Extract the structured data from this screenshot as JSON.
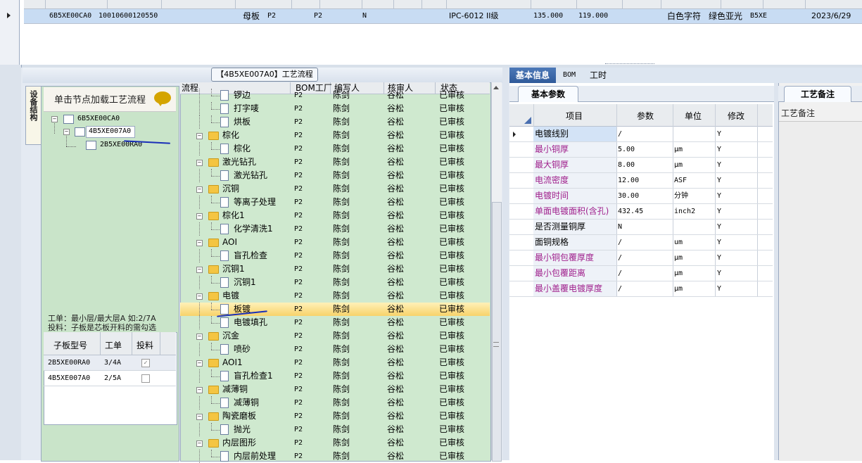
{
  "top_grid": {
    "row": {
      "col1": "6B5XE00CA0",
      "col2": "10010600120550",
      "col3": "母板",
      "col4": "P2",
      "col5": "P2",
      "col6": "N",
      "col7": "IPC-6012 II级",
      "col8": "135.000",
      "col9": "119.000",
      "col10": "白色字符",
      "col11": "绿色亚光",
      "col12": "B5XE",
      "col13": "2023/6/29"
    }
  },
  "workflow": {
    "title": "【4B5XE007A0】工艺流程",
    "vertical_tab": "设备结构",
    "hint": "单击节点加载工艺流程",
    "tree": [
      "6B5XE00CA0",
      "4B5XE007A0",
      "2B5XE00RA0"
    ],
    "info_line1": "工单：最小层/最大层A 如:2/7A",
    "info_line2": "投料：子板是芯板开料的需勾选",
    "sub_table": {
      "headers": [
        "子板型号",
        "工单",
        "投料"
      ],
      "rows": [
        {
          "model": "2B5XE00RA0",
          "order": "3/4A",
          "feed": true
        },
        {
          "model": "4B5XE007A0",
          "order": "2/5A",
          "feed": false
        }
      ]
    }
  },
  "process_grid": {
    "headers": [
      "流程",
      "BOM工厂",
      "编写人",
      "核审人",
      "状态"
    ],
    "rows": [
      {
        "name": "锣边",
        "level": 1,
        "factory": "P2",
        "writer": "陈剑",
        "reviewer": "谷松",
        "status": "已审核"
      },
      {
        "name": "打字唛",
        "level": 1,
        "factory": "P2",
        "writer": "陈剑",
        "reviewer": "谷松",
        "status": "已审核"
      },
      {
        "name": "烘板",
        "level": 1,
        "factory": "P2",
        "writer": "陈剑",
        "reviewer": "谷松",
        "status": "已审核"
      },
      {
        "name": "棕化",
        "level": 0,
        "factory": "P2",
        "writer": "陈剑",
        "reviewer": "谷松",
        "status": "已审核"
      },
      {
        "name": "棕化",
        "level": 1,
        "factory": "P2",
        "writer": "陈剑",
        "reviewer": "谷松",
        "status": "已审核"
      },
      {
        "name": "激光钻孔",
        "level": 0,
        "factory": "P2",
        "writer": "陈剑",
        "reviewer": "谷松",
        "status": "已审核"
      },
      {
        "name": "激光钻孔",
        "level": 1,
        "factory": "P2",
        "writer": "陈剑",
        "reviewer": "谷松",
        "status": "已审核"
      },
      {
        "name": "沉铜",
        "level": 0,
        "factory": "P2",
        "writer": "陈剑",
        "reviewer": "谷松",
        "status": "已审核"
      },
      {
        "name": "等离子处理",
        "level": 1,
        "factory": "P2",
        "writer": "陈剑",
        "reviewer": "谷松",
        "status": "已审核"
      },
      {
        "name": "棕化1",
        "level": 0,
        "factory": "P2",
        "writer": "陈剑",
        "reviewer": "谷松",
        "status": "已审核"
      },
      {
        "name": "化学清洗1",
        "level": 1,
        "factory": "P2",
        "writer": "陈剑",
        "reviewer": "谷松",
        "status": "已审核"
      },
      {
        "name": "AOI",
        "level": 0,
        "factory": "P2",
        "writer": "陈剑",
        "reviewer": "谷松",
        "status": "已审核"
      },
      {
        "name": "盲孔检查",
        "level": 1,
        "factory": "P2",
        "writer": "陈剑",
        "reviewer": "谷松",
        "status": "已审核"
      },
      {
        "name": "沉铜1",
        "level": 0,
        "factory": "P2",
        "writer": "陈剑",
        "reviewer": "谷松",
        "status": "已审核"
      },
      {
        "name": "沉铜1",
        "level": 1,
        "factory": "P2",
        "writer": "陈剑",
        "reviewer": "谷松",
        "status": "已审核"
      },
      {
        "name": "电镀",
        "level": 0,
        "factory": "P2",
        "writer": "陈剑",
        "reviewer": "谷松",
        "status": "已审核"
      },
      {
        "name": "板镀",
        "level": 1,
        "factory": "P2",
        "writer": "陈剑",
        "reviewer": "谷松",
        "status": "已审核"
      },
      {
        "name": "电镀填孔",
        "level": 1,
        "factory": "P2",
        "writer": "陈剑",
        "reviewer": "谷松",
        "status": "已审核"
      },
      {
        "name": "沉金",
        "level": 0,
        "factory": "P2",
        "writer": "陈剑",
        "reviewer": "谷松",
        "status": "已审核"
      },
      {
        "name": "喷砂",
        "level": 1,
        "factory": "P2",
        "writer": "陈剑",
        "reviewer": "谷松",
        "status": "已审核"
      },
      {
        "name": "AOI1",
        "level": 0,
        "factory": "P2",
        "writer": "陈剑",
        "reviewer": "谷松",
        "status": "已审核"
      },
      {
        "name": "盲孔检查1",
        "level": 1,
        "factory": "P2",
        "writer": "陈剑",
        "reviewer": "谷松",
        "status": "已审核"
      },
      {
        "name": "减薄铜",
        "level": 0,
        "factory": "P2",
        "writer": "陈剑",
        "reviewer": "谷松",
        "status": "已审核"
      },
      {
        "name": "减薄铜",
        "level": 1,
        "factory": "P2",
        "writer": "陈剑",
        "reviewer": "谷松",
        "status": "已审核"
      },
      {
        "name": "陶瓷磨板",
        "level": 0,
        "factory": "P2",
        "writer": "陈剑",
        "reviewer": "谷松",
        "status": "已审核"
      },
      {
        "name": "抛光",
        "level": 1,
        "factory": "P2",
        "writer": "陈剑",
        "reviewer": "谷松",
        "status": "已审核"
      },
      {
        "name": "内层图形",
        "level": 0,
        "factory": "P2",
        "writer": "陈剑",
        "reviewer": "谷松",
        "status": "已审核"
      },
      {
        "name": "内层前处理",
        "level": 1,
        "factory": "P2",
        "writer": "陈剑",
        "reviewer": "谷松",
        "status": "已审核"
      }
    ],
    "selected_index": 16
  },
  "right_tabs": [
    "基本信息",
    "BOM",
    "工时"
  ],
  "basic_params": {
    "tab": "基本参数",
    "headers": [
      "项目",
      "参数",
      "单位",
      "修改"
    ],
    "rows": [
      {
        "item": "电镀线别",
        "value": "/",
        "unit": "",
        "edit": "Y",
        "highlight": false
      },
      {
        "item": "最小铜厚",
        "value": "5.00",
        "unit": "μm",
        "edit": "Y",
        "highlight": true
      },
      {
        "item": "最大铜厚",
        "value": "8.00",
        "unit": "μm",
        "edit": "Y",
        "highlight": true
      },
      {
        "item": "电流密度",
        "value": "12.00",
        "unit": "ASF",
        "edit": "Y",
        "highlight": true
      },
      {
        "item": "电镀时间",
        "value": "30.00",
        "unit": "分钟",
        "edit": "Y",
        "highlight": true
      },
      {
        "item": "单面电镀面积(含孔)",
        "value": "432.45",
        "unit": "inch2",
        "edit": "Y",
        "highlight": true
      },
      {
        "item": "是否测量铜厚",
        "value": "N",
        "unit": "",
        "edit": "Y",
        "highlight": false
      },
      {
        "item": "面铜规格",
        "value": "/",
        "unit": "um",
        "edit": "Y",
        "highlight": false
      },
      {
        "item": "最小铜包覆厚度",
        "value": "/",
        "unit": "μm",
        "edit": "Y",
        "highlight": true
      },
      {
        "item": "最小包覆距离",
        "value": "/",
        "unit": "μm",
        "edit": "Y",
        "highlight": true
      },
      {
        "item": "最小盖覆电镀厚度",
        "value": "/",
        "unit": "μm",
        "edit": "Y",
        "highlight": true
      }
    ]
  },
  "remark": {
    "tab": "工艺备注",
    "label": "工艺备注"
  },
  "colors": {
    "tree_bg": "#c9e4c9",
    "grid_bg": "#cfe9cf",
    "highlight_text": "#a0208c",
    "tab_active": "#2f5a9a"
  }
}
